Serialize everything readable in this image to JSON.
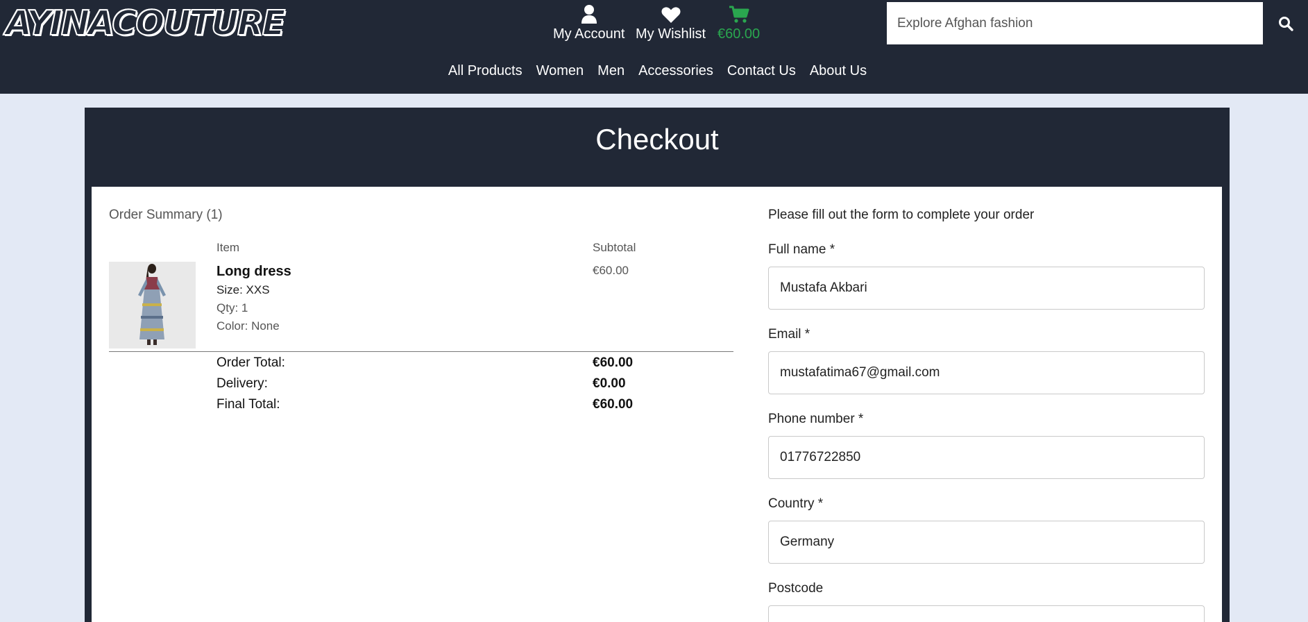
{
  "header": {
    "logo": "AYINACOUTURE",
    "account_label": "My Account",
    "wishlist_label": "My Wishlist",
    "cart_total": "€60.00",
    "search_placeholder": "Explore Afghan fashion"
  },
  "nav": {
    "items": [
      "All Products",
      "Women",
      "Men",
      "Accessories",
      "Contact Us",
      "About Us"
    ]
  },
  "checkout": {
    "title": "Checkout",
    "summary_title": "Order Summary (1)",
    "col_item": "Item",
    "col_subtotal": "Subtotal",
    "item": {
      "name": "Long dress",
      "size": "Size: XXS",
      "qty": "Qty: 1",
      "color": "Color: None",
      "subtotal": "€60.00"
    },
    "totals": {
      "order_total_label": "Order Total:",
      "order_total": "€60.00",
      "delivery_label": "Delivery:",
      "delivery": "€0.00",
      "final_total_label": "Final Total:",
      "final_total": "€60.00"
    }
  },
  "form": {
    "intro": "Please fill out the form to complete your order",
    "full_name_label": "Full name *",
    "full_name": "Mustafa Akbari",
    "email_label": "Email *",
    "email": "mustafatima67@gmail.com",
    "phone_label": "Phone number *",
    "phone": "01776722850",
    "country_label": "Country *",
    "country": "Germany",
    "postcode_label": "Postcode",
    "postcode": ""
  },
  "colors": {
    "header_bg": "#212836",
    "page_bg": "#e3e9f5",
    "cart_green": "#2aa64f"
  }
}
